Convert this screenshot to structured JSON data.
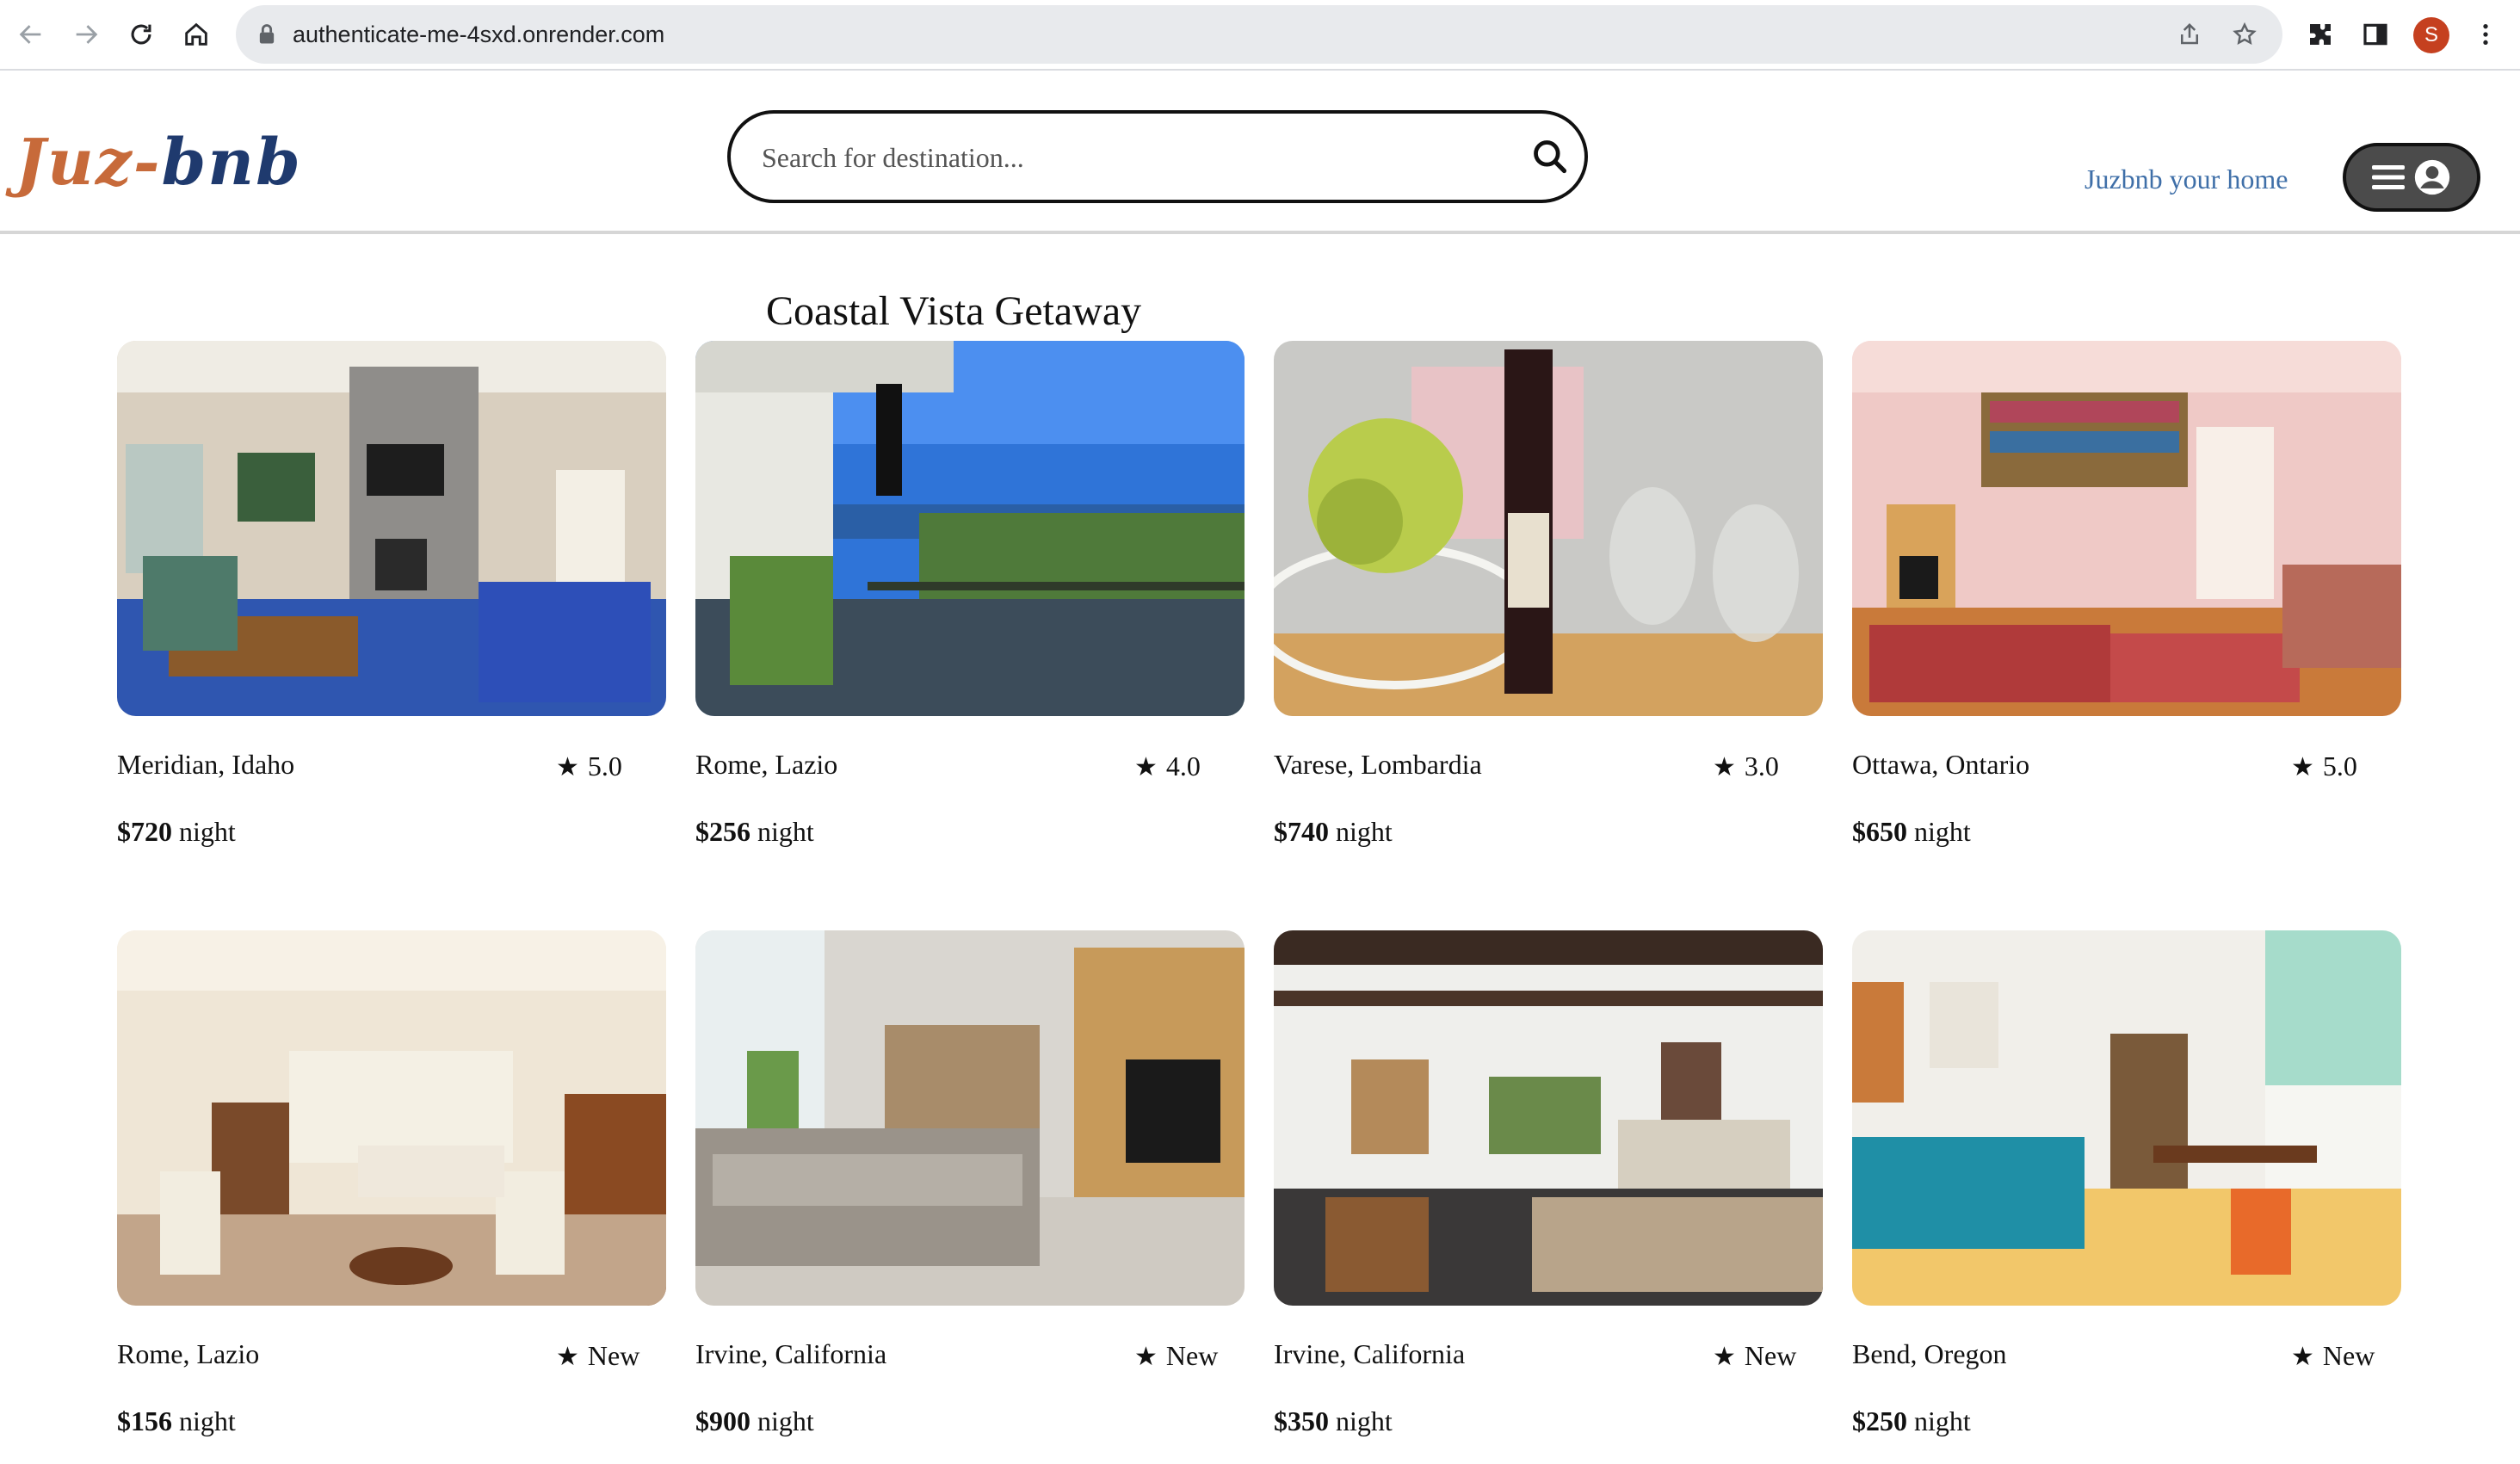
{
  "browser": {
    "url": "authenticate-me-4sxd.onrender.com",
    "profile_initial": "S"
  },
  "header": {
    "logo_part1": "Juz",
    "logo_sep": "-",
    "logo_part2": "bnb",
    "search_placeholder": "Search for destination...",
    "host_link": "Juzbnb your home"
  },
  "hover_title": "Coastal Vista Getaway",
  "listings": [
    {
      "location": "Meridian, Idaho",
      "rating": "5.0",
      "price": "$720",
      "unit": "night"
    },
    {
      "location": "Rome, Lazio",
      "rating": "4.0",
      "price": "$256",
      "unit": "night"
    },
    {
      "location": "Varese, Lombardia",
      "rating": "3.0",
      "price": "$740",
      "unit": "night"
    },
    {
      "location": "Ottawa, Ontario",
      "rating": "5.0",
      "price": "$650",
      "unit": "night"
    },
    {
      "location": "Rome, Lazio",
      "rating": "New",
      "price": "$156",
      "unit": "night"
    },
    {
      "location": "Irvine, California",
      "rating": "New",
      "price": "$900",
      "unit": "night"
    },
    {
      "location": "Irvine, California",
      "rating": "New",
      "price": "$350",
      "unit": "night"
    },
    {
      "location": "Bend, Oregon",
      "rating": "New",
      "price": "$250",
      "unit": "night"
    }
  ]
}
